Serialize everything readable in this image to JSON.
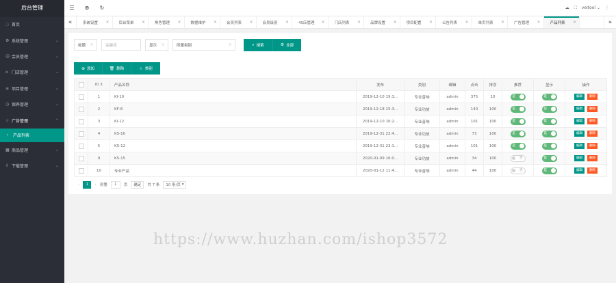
{
  "sidebar": {
    "title": "后台管理",
    "items": [
      {
        "icon": "◌",
        "label": "首页",
        "arrow": ""
      },
      {
        "icon": "⚙",
        "label": "系统管理",
        "arrow": "⌄"
      },
      {
        "icon": "☺",
        "label": "会员管理",
        "arrow": "⌄"
      },
      {
        "icon": "⌂",
        "label": "门店管理",
        "arrow": "⌄"
      },
      {
        "icon": "≡",
        "label": "项目管理",
        "arrow": "⌄"
      },
      {
        "icon": "◷",
        "label": "保养管理",
        "arrow": "⌄"
      },
      {
        "icon": "☆",
        "label": "广告管理",
        "arrow": "⌃"
      }
    ],
    "sub": {
      "icon": "›",
      "label": "产品列表"
    },
    "after": [
      {
        "icon": "▦",
        "label": "商品管理",
        "arrow": "⌄"
      },
      {
        "icon": "⇩",
        "label": "下载管理",
        "arrow": "⌄"
      }
    ]
  },
  "topbar": {
    "menu_icon": "☰",
    "globe_icon": "⊕",
    "refresh_icon": "↻",
    "right": {
      "icon1": "☁",
      "icon2": "⛶",
      "user": "veitool",
      "caret": "⌄",
      "more": "⋮"
    }
  },
  "tabs": {
    "prev": "«",
    "next": "»",
    "close": "×",
    "items": [
      "系统设置",
      "后台菜单",
      "角色管理",
      "数据维护",
      "会员列表",
      "会员级别",
      "4S店管理",
      "门店列表",
      "品牌设置",
      "项目配置",
      "公告列表",
      "单页列表",
      "广告管理",
      "产品列表"
    ],
    "active": 13
  },
  "filters": {
    "field": "标题",
    "keyword_placeholder": "关键词",
    "state": "显示",
    "category": "所属类别",
    "search": "搜索",
    "all": "全部"
  },
  "actions": {
    "add": "添加",
    "delete": "删除",
    "recommend": "类别"
  },
  "table": {
    "headers": {
      "id": "ID",
      "sort_icon": "⇕",
      "name": "产品名称",
      "time": "发布",
      "category": "类别",
      "user": "编辑",
      "hits": "点击",
      "order": "排序",
      "recommend": "推荐",
      "show": "显示",
      "op": "操作"
    },
    "edit_label": "编辑",
    "del_label": "删除",
    "on_text": "是",
    "off_text": "否",
    "rows": [
      {
        "id": "1",
        "name": "KI-10",
        "time": "2019-12-10 19:3...",
        "category": "专业音响",
        "user": "admin",
        "hits": "375",
        "order": "10",
        "recommend": true,
        "show": true
      },
      {
        "id": "2",
        "name": "KF-8",
        "time": "2019-12-18 15:3...",
        "category": "专业功放",
        "user": "admin",
        "hits": "140",
        "order": "100",
        "recommend": true,
        "show": true
      },
      {
        "id": "3",
        "name": "KI-12",
        "time": "2019-12-10 16:2...",
        "category": "专业音响",
        "user": "admin",
        "hits": "101",
        "order": "100",
        "recommend": true,
        "show": true
      },
      {
        "id": "4",
        "name": "KS-10",
        "time": "2019-12-31 22:4...",
        "category": "专业功放",
        "user": "admin",
        "hits": "73",
        "order": "100",
        "recommend": true,
        "show": true
      },
      {
        "id": "5",
        "name": "KS-12",
        "time": "2019-12-31 23:1...",
        "category": "专业音响",
        "user": "admin",
        "hits": "101",
        "order": "100",
        "recommend": true,
        "show": true
      },
      {
        "id": "9",
        "name": "KS-15",
        "time": "2020-01-09 16:0...",
        "category": "专业功放",
        "user": "admin",
        "hits": "34",
        "order": "100",
        "recommend": false,
        "show": true
      },
      {
        "id": "10",
        "name": "专业产品",
        "time": "2020-01-12 11:4...",
        "category": "专业音响",
        "user": "admin",
        "hits": "44",
        "order": "100",
        "recommend": false,
        "show": true
      }
    ]
  },
  "pager": {
    "prev": "‹",
    "current": "1",
    "next": "›",
    "goto_label": "到第",
    "page_value": "1",
    "page_unit": "页",
    "confirm": "确定",
    "total": "共 7 条",
    "limit": "10 条/页",
    "limit_caret": "▾"
  },
  "watermark": "https://www.huzhan.com/ishop3572"
}
